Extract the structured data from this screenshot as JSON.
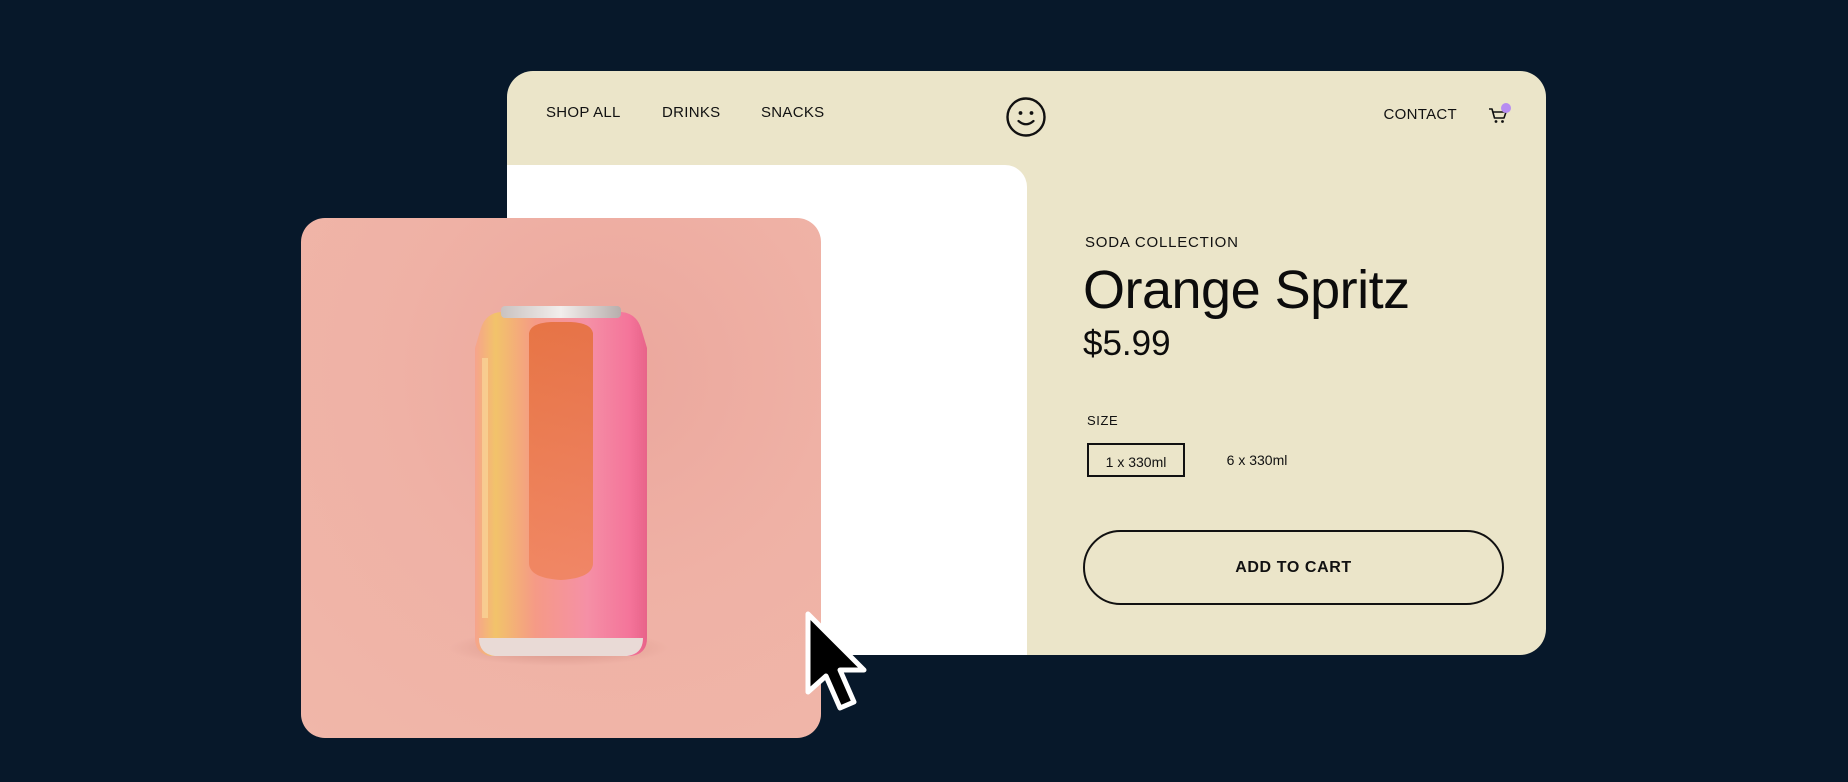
{
  "nav": {
    "links": [
      "SHOP ALL",
      "DRINKS",
      "SNACKS"
    ],
    "contact": "CONTACT",
    "logo_icon": "smiley-icon",
    "cart_icon": "cart-icon"
  },
  "product": {
    "collection": "SODA COLLECTION",
    "name": "Orange Spritz",
    "price": "$5.99",
    "size_label": "SIZE",
    "sizes": [
      "1 x 330ml",
      "6 x 330ml"
    ],
    "selected_size": "1 x 330ml",
    "add_to_cart": "ADD TO CART"
  },
  "colors": {
    "background": "#07182a",
    "window": "#ebe5c9",
    "cart_badge": "#b78cf2",
    "photo_bg": "#efb1a5"
  }
}
